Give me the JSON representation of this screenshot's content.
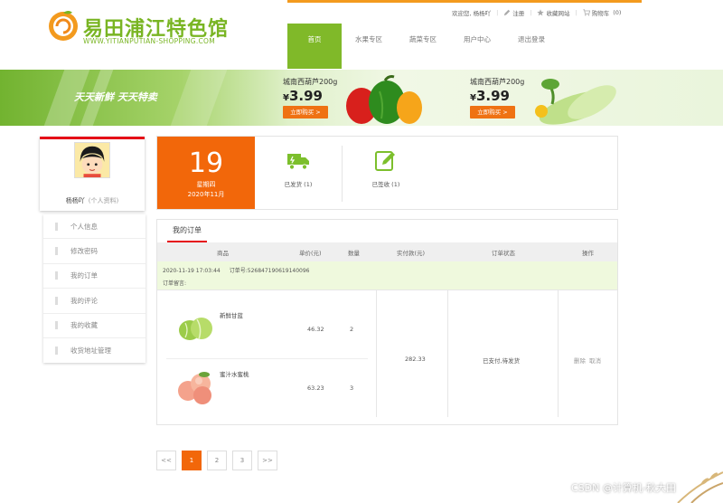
{
  "brand": {
    "name_parts": [
      "易田浦江特色馆"
    ],
    "url": "WWW.YITIANPUTIAN-SHOPPING.COM"
  },
  "top_links": {
    "welcome": "欢迎您,",
    "user": "杨杨吖",
    "sep": "|",
    "register": "注册",
    "favorite": "收藏网站",
    "cart": "购物车",
    "cart_count": "(0)"
  },
  "nav": [
    {
      "label": "首页",
      "active": true
    },
    {
      "label": "水果专区",
      "active": false
    },
    {
      "label": "蔬菜专区",
      "active": false
    },
    {
      "label": "用户中心",
      "active": false
    },
    {
      "label": "退出登录",
      "active": false
    }
  ],
  "banner": {
    "slogan": "天天新鲜 天天特卖",
    "promos": [
      {
        "title": "城南西葫芦200g",
        "currency": "¥",
        "price": "3.99",
        "button": "立即购买 >"
      },
      {
        "title": "城南西葫芦200g",
        "currency": "¥",
        "price": "3.99",
        "button": "立即购买 >"
      }
    ]
  },
  "profile": {
    "username": "杨杨吖",
    "subtitle": "(个人资料)"
  },
  "side_menu": [
    "个人信息",
    "修改密码",
    "我的订单",
    "我的评论",
    "我的收藏",
    "收货地址管理"
  ],
  "stats": {
    "day": "19",
    "weekday": "星期四",
    "year_month": "2020年11月",
    "shipped": "已发货 (1)",
    "received": "已签收 (1)"
  },
  "orders": {
    "tab": "我的订单",
    "headers": {
      "product": "商品",
      "unit_price": "单价(元)",
      "qty": "数量",
      "paid": "实付款(元)",
      "status": "订单状态",
      "ops": "操作"
    },
    "order": {
      "datetime": "2020-11-19 17:03:44",
      "number": "订单号:526847190619140096",
      "note": "订单留言:",
      "paid": "282.33",
      "status": "已支付,待发货",
      "ops": [
        "删除",
        "取消"
      ],
      "items": [
        {
          "name": "新鲜甘蓝",
          "price": "46.32",
          "qty": "2"
        },
        {
          "name": "蜜汁水蜜桃",
          "price": "63.23",
          "qty": "3"
        }
      ]
    }
  },
  "pagination": [
    "<<",
    "1",
    "2",
    "3",
    ">>"
  ],
  "pagination_active": "1",
  "watermark": "CSDN @计算机-秋大田",
  "colors": {
    "green": "#80b929",
    "orange": "#f2670a",
    "red": "#e50e17"
  }
}
